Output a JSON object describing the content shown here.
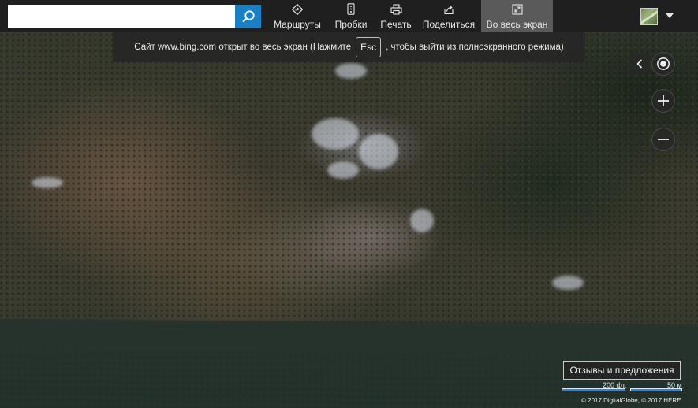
{
  "search": {
    "value": "",
    "placeholder": ""
  },
  "toolbar": {
    "routes": "Маршруты",
    "traffic": "Пробки",
    "print": "Печать",
    "share": "Поделиться",
    "fullscreen": "Во весь экран"
  },
  "notice": {
    "before": "Сайт www.bing.com открыт во весь экран (Нажмите",
    "key": "Esc",
    "after": ", чтобы выйти из полноэкранного режима)"
  },
  "feedback_label": "Отзывы и предложения",
  "scale": {
    "imperial": "200 фт.",
    "metric": "50 м"
  },
  "copyright": "© 2017 DigitalGlobe, © 2017 HERE",
  "colors": {
    "accent": "#1b7fc4",
    "toolbar_bg": "#1f1f1f",
    "active_tab": "#5a5a5a"
  },
  "icons": [
    "search-icon",
    "directions-icon",
    "traffic-icon",
    "print-icon",
    "share-icon",
    "fullscreen-icon",
    "chevron-left-icon",
    "locate-icon",
    "plus-icon",
    "minus-icon",
    "caret-down-icon"
  ]
}
